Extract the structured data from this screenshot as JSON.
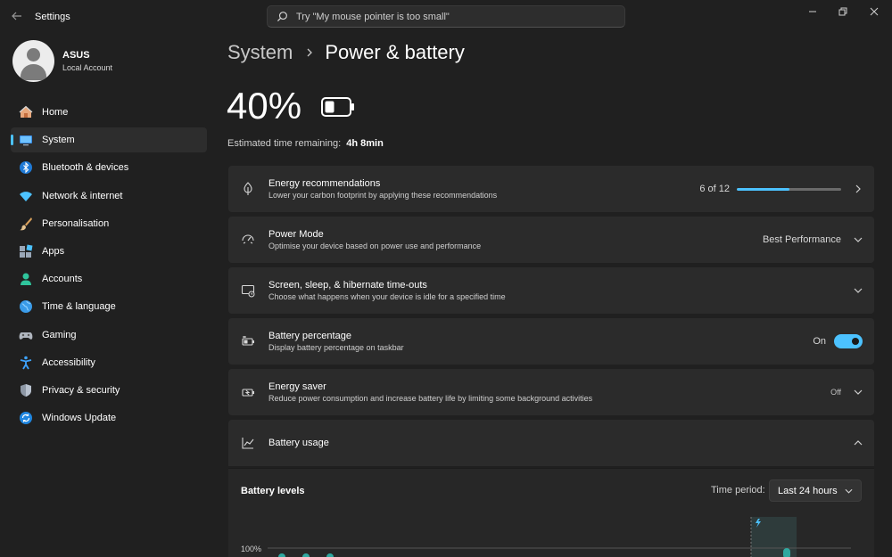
{
  "window": {
    "title": "Settings",
    "search_placeholder": "Try \"My mouse pointer is too small\""
  },
  "profile": {
    "name": "ASUS",
    "account_type": "Local Account"
  },
  "sidebar": {
    "items": [
      {
        "label": "Home",
        "icon": "home-icon",
        "active": false
      },
      {
        "label": "System",
        "icon": "system-icon",
        "active": true
      },
      {
        "label": "Bluetooth & devices",
        "icon": "bluetooth-icon",
        "active": false
      },
      {
        "label": "Network & internet",
        "icon": "wifi-icon",
        "active": false
      },
      {
        "label": "Personalisation",
        "icon": "brush-icon",
        "active": false
      },
      {
        "label": "Apps",
        "icon": "apps-icon",
        "active": false
      },
      {
        "label": "Accounts",
        "icon": "accounts-icon",
        "active": false
      },
      {
        "label": "Time & language",
        "icon": "globe-icon",
        "active": false
      },
      {
        "label": "Gaming",
        "icon": "gamepad-icon",
        "active": false
      },
      {
        "label": "Accessibility",
        "icon": "accessibility-icon",
        "active": false
      },
      {
        "label": "Privacy & security",
        "icon": "shield-icon",
        "active": false
      },
      {
        "label": "Windows Update",
        "icon": "update-icon",
        "active": false
      }
    ]
  },
  "breadcrumb": {
    "parent": "System",
    "current": "Power & battery"
  },
  "battery": {
    "percent_text": "40%",
    "level": 0.4,
    "estimate_label": "Estimated time remaining:",
    "estimate_value": "4h 8min"
  },
  "cards": {
    "energy_recommendations": {
      "title": "Energy recommendations",
      "description": "Lower your carbon footprint by applying these recommendations",
      "progress_text": "6 of 12",
      "progress_done": 6,
      "progress_total": 12
    },
    "power_mode": {
      "title": "Power Mode",
      "description": "Optimise your device based on power use and performance",
      "value": "Best Performance"
    },
    "screen_sleep": {
      "title": "Screen, sleep, & hibernate time-outs",
      "description": "Choose what happens when your device is idle for a specified time"
    },
    "battery_percentage": {
      "title": "Battery percentage",
      "description": "Display battery percentage on taskbar",
      "state_label": "On",
      "enabled": true
    },
    "energy_saver": {
      "title": "Energy saver",
      "description": "Reduce power consumption and increase battery life by limiting some background activities",
      "state_label": "Off"
    },
    "battery_usage": {
      "title": "Battery usage"
    }
  },
  "battery_levels": {
    "title": "Battery levels",
    "time_period_label": "Time period:",
    "time_period_value": "Last 24 hours",
    "y_tick_top": "100%"
  },
  "colors": {
    "accent": "#4cc2ff",
    "background": "#202020",
    "card": "#2b2b2b"
  }
}
